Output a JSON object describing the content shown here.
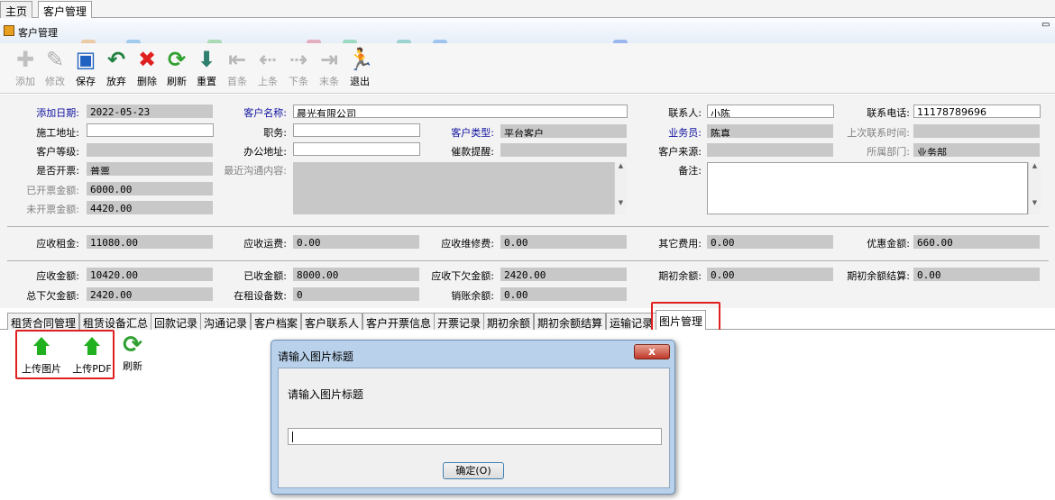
{
  "tabs": [
    "主页",
    "客户管理"
  ],
  "window": {
    "title": "客户管理"
  },
  "toolbar": [
    {
      "label": "添加",
      "icon": "plus-icon",
      "enabled": false
    },
    {
      "label": "修改",
      "icon": "edit-icon",
      "enabled": false
    },
    {
      "label": "保存",
      "icon": "floppy-disk-icon",
      "enabled": true
    },
    {
      "label": "放弃",
      "icon": "undo-arrow-icon",
      "enabled": true
    },
    {
      "label": "删除",
      "icon": "red-x-icon",
      "enabled": true
    },
    {
      "label": "刷新",
      "icon": "refresh-icon",
      "enabled": true
    },
    {
      "label": "重置",
      "icon": "reset-icon",
      "enabled": true
    },
    {
      "label": "首条",
      "icon": "first-record-icon",
      "enabled": false
    },
    {
      "label": "上条",
      "icon": "previous-record-icon",
      "enabled": false
    },
    {
      "label": "下条",
      "icon": "next-record-icon",
      "enabled": false
    },
    {
      "label": "末条",
      "icon": "last-record-icon",
      "enabled": false
    },
    {
      "label": "退出",
      "icon": "running-man-exit-icon",
      "enabled": true
    }
  ],
  "form": {
    "add_date_label": "添加日期:",
    "add_date": "2022-05-23",
    "customer_name_label": "客户名称:",
    "customer_name": "晨光有限公司",
    "contact_label": "联系人:",
    "contact": "小陈",
    "phone_label": "联系电话:",
    "phone": "11178789696",
    "site_address_label": "施工地址:",
    "site_address": "",
    "position_label": "职务:",
    "position": "",
    "customer_type_label": "客户类型:",
    "customer_type": "平台客户",
    "salesperson_label": "业务员:",
    "salesperson": "陈真",
    "last_contact_label": "上次联系时间:",
    "last_contact": "",
    "customer_level_label": "客户等级:",
    "customer_level": "",
    "office_address_label": "办公地址:",
    "office_address": "",
    "payment_reminder_label": "催款提醒:",
    "payment_reminder": "",
    "customer_source_label": "客户来源:",
    "customer_source": "",
    "department_label": "所属部门:",
    "department": "业务部",
    "invoice_label": "是否开票:",
    "invoice": "普票",
    "recent_comm_label": "最近沟通内容:",
    "recent_comm": "",
    "remarks_label": "备注:",
    "remarks": "",
    "invoiced_amount_label": "已开票金额:",
    "invoiced_amount": "6000.00",
    "uninvoiced_amount_label": "未开票金额:",
    "uninvoiced_amount": "4420.00"
  },
  "fees": {
    "rent_label": "应收租金:",
    "rent": "11080.00",
    "freight_label": "应收运费:",
    "freight": "0.00",
    "repair_label": "应收维修费:",
    "repair": "0.00",
    "other_label": "其它费用:",
    "other": "0.00",
    "discount_label": "优惠金额:",
    "discount": "660.00"
  },
  "totals": {
    "receivable_label": "应收金额:",
    "receivable": "10420.00",
    "received_label": "已收金额:",
    "received": "8000.00",
    "outstanding_label": "应收下欠金额:",
    "outstanding": "2420.00",
    "opening_label": "期初余额:",
    "opening": "0.00",
    "opening_settle_label": "期初余额结算:",
    "opening_settle": "0.00",
    "total_owed_label": "总下欠金额:",
    "total_owed": "2420.00",
    "equipment_label": "在租设备数:",
    "equipment": "0",
    "writeoff_label": "销账余额:",
    "writeoff": "0.00"
  },
  "detail_tabs": [
    "租赁合同管理",
    "租赁设备汇总",
    "回款记录",
    "沟通记录",
    "客户档案",
    "客户联系人",
    "客户开票信息",
    "开票记录",
    "期初余额",
    "期初余额结算",
    "运输记录",
    "图片管理"
  ],
  "panel_buttons": [
    {
      "label": "上传图片",
      "icon": "green-up-arrow-icon"
    },
    {
      "label": "上传PDF",
      "icon": "green-up-arrow-icon"
    },
    {
      "label": "刷新",
      "icon": "refresh-icon"
    }
  ],
  "dialog": {
    "title": "请输入图片标题",
    "prompt": "请输入图片标题",
    "value": "",
    "ok_label": "确定(O)",
    "close_symbol": "x"
  },
  "colors": {
    "highlight": "#e02020",
    "blue_label": "#1010a0",
    "readonly_field": "#c8c8c8"
  }
}
